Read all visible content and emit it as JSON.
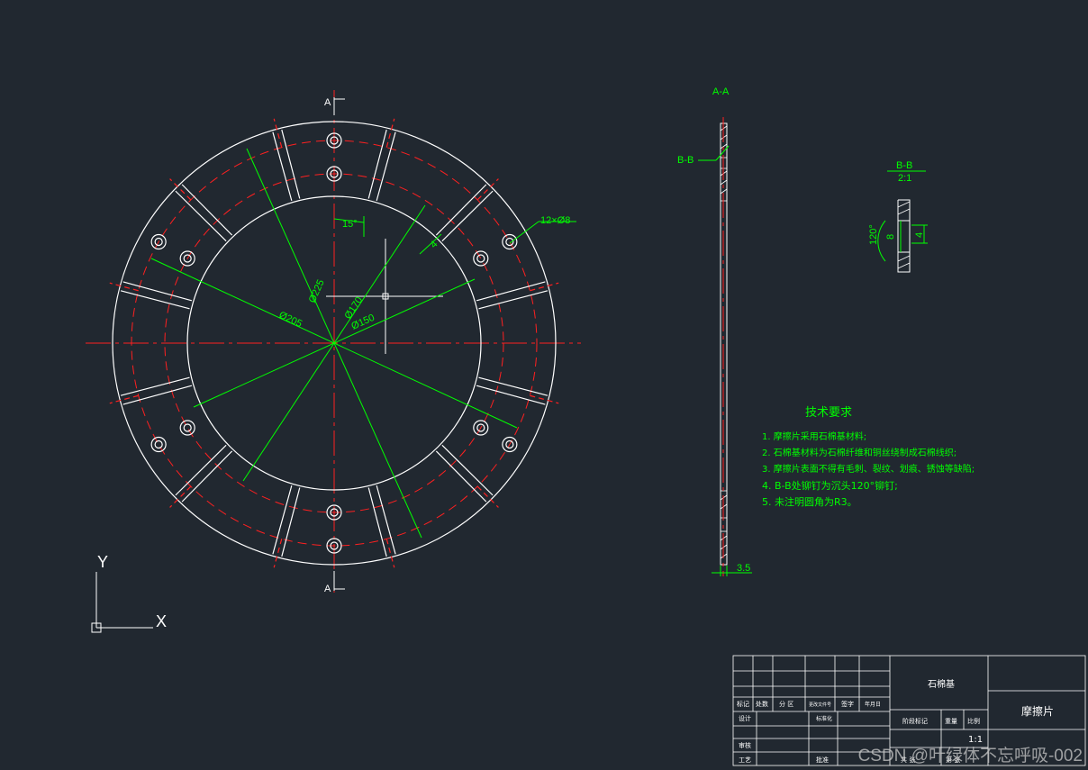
{
  "colors": {
    "background": "#212830",
    "outline": "#ffffff",
    "center_line": "#ff2020",
    "dimension": "#00ff00"
  },
  "front_view": {
    "section_mark_top": "A",
    "section_mark_bottom": "A",
    "dims": {
      "d225": "Ø225",
      "d205": "Ø205",
      "d170": "Ø170",
      "d150": "Ø150",
      "angle": "15°",
      "holes": "12×Ø8",
      "small": "4"
    }
  },
  "section_view": {
    "title": "A-A",
    "callout": "B-B",
    "thickness": "3.5"
  },
  "detail_view": {
    "title": "B-B",
    "scale": "2:1",
    "angle": "120°",
    "dim_8": "8",
    "dim_4": "4"
  },
  "tech_requirements": {
    "title": "技术要求",
    "items": [
      "1. 摩擦片采用石棉基材料;",
      "2. 石棉基材料为石棉纤维和铜丝绕制成石棉线织;",
      "3. 摩擦片表面不得有毛刺、裂纹、划痕、锈蚀等缺陷;",
      "4. B-B处铆钉为沉头120°铆钉;",
      "5. 未注明圆角为R3。"
    ]
  },
  "title_block": {
    "material": "石棉基",
    "part_name": "摩擦片",
    "scale": "1:1",
    "row_labels": [
      "标记",
      "处数",
      "分 区",
      "更改文件号",
      "签字",
      "年月日"
    ],
    "design": "设计",
    "standardize": "标准化",
    "stage_mark": "阶段标记",
    "weight": "重量",
    "ratio": "比例",
    "review": "审核",
    "process": "工艺",
    "approve": "批准",
    "sheet_total": "共 张",
    "sheet_no": "第 张"
  },
  "ucs": {
    "x": "X",
    "y": "Y"
  },
  "watermark": "CSDN @叶绿体不忘呼吸-002"
}
